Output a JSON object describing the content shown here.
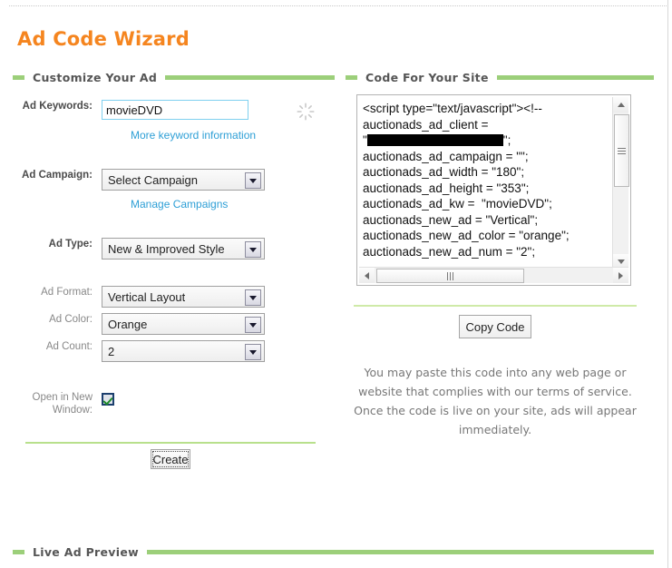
{
  "page": {
    "title": "Ad Code Wizard"
  },
  "sections": {
    "customize": "Customize Your Ad",
    "code": "Code For Your Site",
    "preview": "Live Ad Preview"
  },
  "form": {
    "keywords": {
      "label": "Ad Keywords:",
      "value": "movieDVD",
      "placeholder": "",
      "help_link": "More keyword information"
    },
    "campaign": {
      "label": "Ad Campaign:",
      "value": "Select Campaign",
      "manage_link": "Manage Campaigns"
    },
    "ad_type": {
      "label": "Ad Type:",
      "value": "New & Improved Style"
    },
    "ad_format": {
      "label": "Ad Format:",
      "value": "Vertical Layout"
    },
    "ad_color": {
      "label": "Ad Color:",
      "value": "Orange"
    },
    "ad_count": {
      "label": "Ad Count:",
      "value": "2"
    },
    "new_window": {
      "label": "Open in New\nWindow:",
      "checked": true
    },
    "create_button": "Create"
  },
  "code_panel": {
    "lines": [
      "<script type=\"text/javascript\"><!--",
      "auctionads_ad_client =",
      "\"██████████\";",
      "auctionads_ad_campaign = \"\";",
      "auctionads_ad_width = \"180\";",
      "auctionads_ad_height = \"353\";",
      "auctionads_ad_kw =  \"movieDVD\";",
      "auctionads_new_ad = \"Vertical\";",
      "auctionads_new_ad_color = \"orange\";",
      "auctionads_new_ad_num = \"2\";"
    ],
    "copy_button": "Copy Code",
    "note": "You may paste this code into any web page or website that complies with our terms of service. Once the code is live on your site, ads will appear immediately."
  },
  "colors": {
    "title_orange": "#f5851f",
    "section_green": "#9ccf7a",
    "link_blue": "#2e9fd6",
    "input_border": "#7fd0ef"
  }
}
